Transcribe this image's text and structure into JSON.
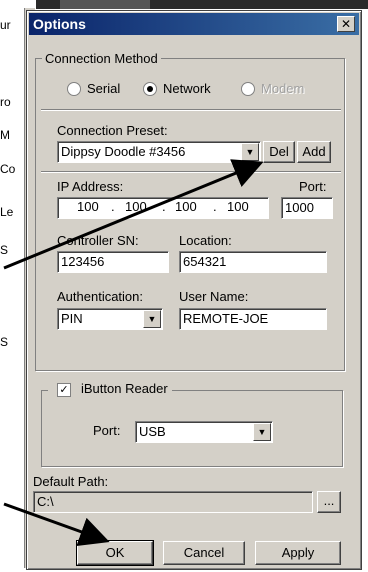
{
  "window": {
    "title": "Options"
  },
  "connection_method": {
    "legend": "Connection Method",
    "options": [
      {
        "label": "Serial",
        "selected": false,
        "enabled": true
      },
      {
        "label": "Network",
        "selected": true,
        "enabled": true
      },
      {
        "label": "Modem",
        "selected": false,
        "enabled": false
      }
    ],
    "preset_label": "Connection Preset:",
    "preset_value": "Dippsy Doodle #3456",
    "del_label": "Del",
    "add_label": "Add",
    "ip_label": "IP Address:",
    "ip_octets": [
      "100",
      "100",
      "100",
      "100"
    ],
    "port_label": "Port:",
    "port_value": "1000",
    "controller_sn_label": "Controller SN:",
    "controller_sn_value": "123456",
    "location_label": "Location:",
    "location_value": "654321",
    "auth_label": "Authentication:",
    "auth_value": "PIN",
    "username_label": "User Name:",
    "username_value": "REMOTE-JOE"
  },
  "ibutton": {
    "label": "iButton Reader",
    "checked": true,
    "port_label": "Port:",
    "port_value": "USB"
  },
  "default_path": {
    "label": "Default Path:",
    "value": "C:\\",
    "browse_label": "..."
  },
  "buttons": {
    "ok": "OK",
    "cancel": "Cancel",
    "apply": "Apply"
  },
  "background": {
    "fragments": [
      "ur",
      "ro",
      "M",
      "Co",
      "Le",
      "S",
      "S"
    ]
  }
}
